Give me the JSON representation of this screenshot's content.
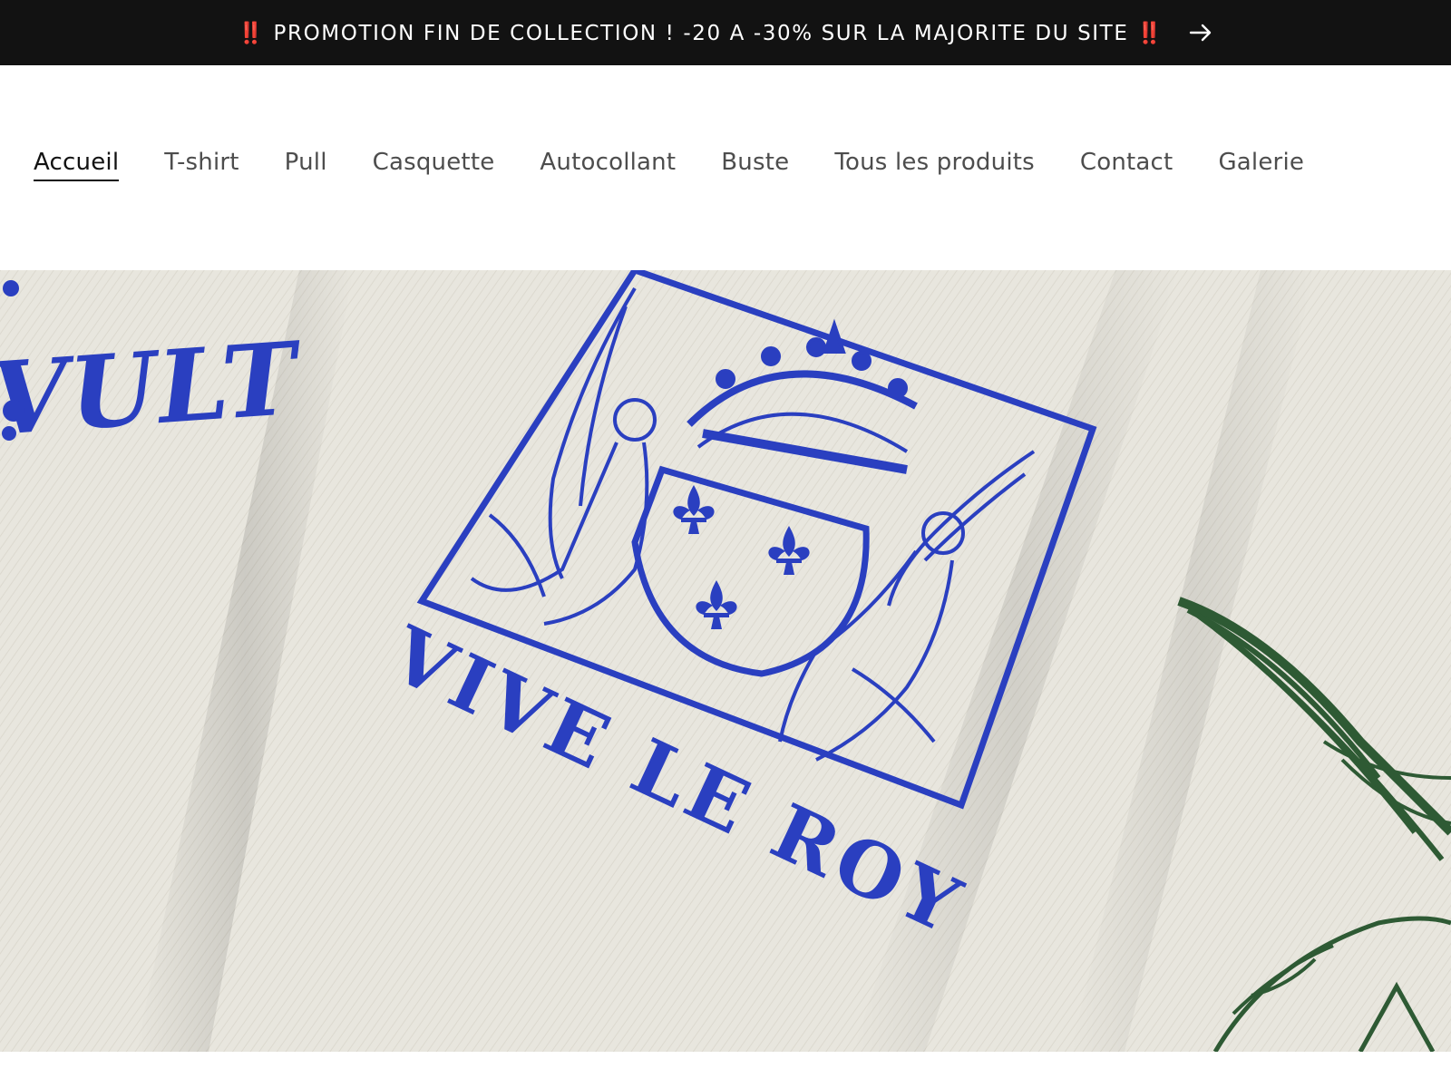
{
  "announcement": {
    "text": "‼️ PROMOTION FIN DE COLLECTION ! -20 A -30% SUR LA MAJORITE DU SITE ‼️",
    "link_icon": "arrow-right-icon"
  },
  "nav": {
    "items": [
      {
        "label": "Accueil",
        "active": true
      },
      {
        "label": "T-shirt",
        "active": false
      },
      {
        "label": "Pull",
        "active": false
      },
      {
        "label": "Casquette",
        "active": false
      },
      {
        "label": "Autocollant",
        "active": false
      },
      {
        "label": "Buste",
        "active": false
      },
      {
        "label": "Tous les produits",
        "active": false
      },
      {
        "label": "Contact",
        "active": false
      },
      {
        "label": "Galerie",
        "active": false
      }
    ]
  },
  "hero": {
    "print_left_text": "VULT",
    "print_main_text": "VIVE LE ROY",
    "colors": {
      "fabric": "#e9e7df",
      "print_blue": "#2a3fc0",
      "print_green": "#2e5a34"
    }
  }
}
